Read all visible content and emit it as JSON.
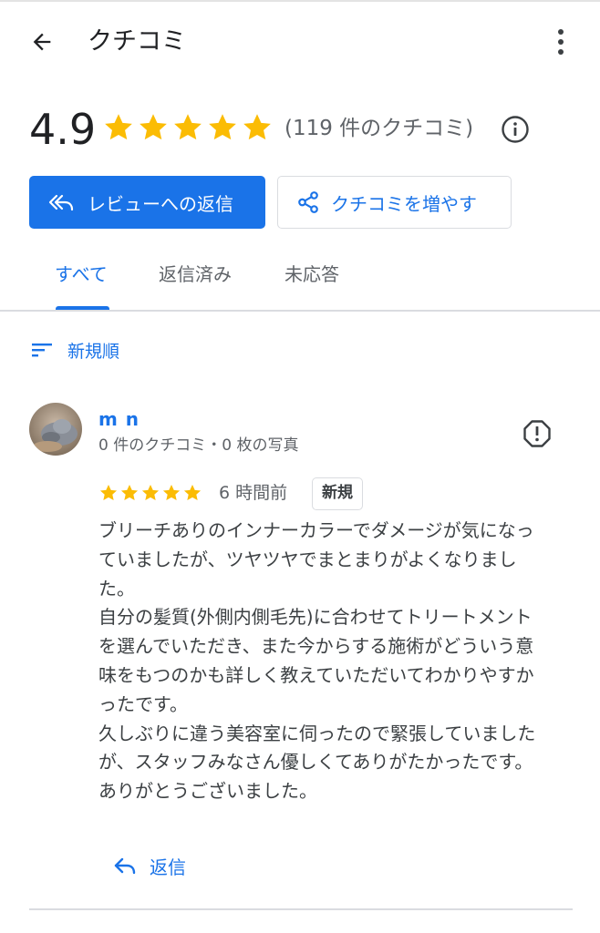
{
  "app_bar": {
    "title": "クチコミ"
  },
  "summary": {
    "score": "4.9",
    "stars": 5,
    "review_count": "(119 件のクチコミ)"
  },
  "actions": {
    "reply_label": "レビューへの返信",
    "get_more_label": "クチコミを増やす"
  },
  "tabs": [
    {
      "label": "すべて",
      "active": true
    },
    {
      "label": "返信済み",
      "active": false
    },
    {
      "label": "未応答",
      "active": false
    }
  ],
  "sort": {
    "label": "新規順"
  },
  "review": {
    "reviewer_name": "m n",
    "reviewer_meta": "0 件のクチコミ・0 枚の写真",
    "rating": 5,
    "time": "6 時間前",
    "badge": "新規",
    "text_lines": [
      "ブリーチありのインナーカラーでダメージが気になっ",
      "ていましたが、ツヤツヤでまとまりがよくなりまし",
      "た。",
      "自分の髪質(外側内側毛先)に合わせてトリートメント",
      "を選んでいただき、また今からする施術がどういう意",
      "味をもつのかも詳しく教えていただいてわかりやすか",
      "ったです。",
      "久しぶりに違う美容室に伺ったので緊張していました",
      "が、スタッフみなさん優しくてありがたかったです。",
      "ありがとうございました。"
    ],
    "reply_label": "返信"
  },
  "colors": {
    "accent": "#1a73e8",
    "star": "#fbbc04",
    "text_primary": "#202124",
    "text_secondary": "#5f6368",
    "divider": "#dadce0"
  },
  "icons": {
    "back": "arrow-back-icon",
    "more": "more-vert-icon",
    "info": "info-icon",
    "reply_all": "reply-all-icon",
    "share": "share-icon",
    "sort": "sort-icon",
    "report": "report-icon",
    "reply": "reply-icon"
  }
}
